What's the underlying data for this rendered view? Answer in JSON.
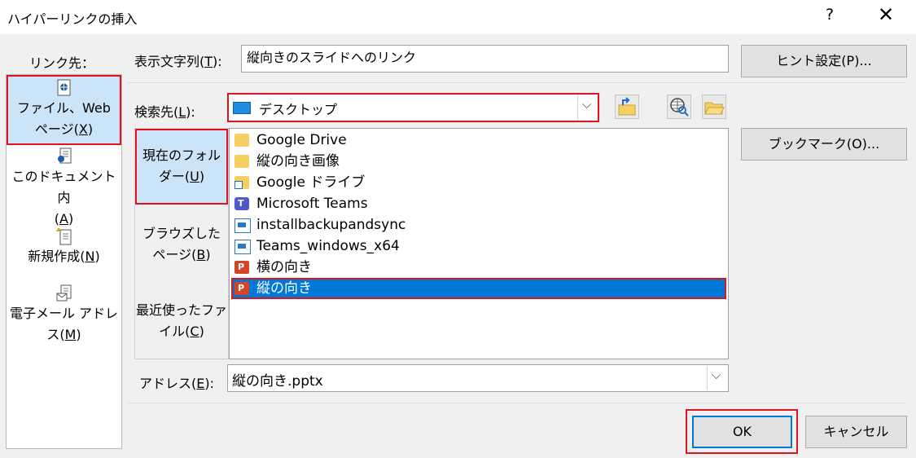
{
  "dialog": {
    "title": "ハイパーリンクの挿入",
    "help": "?",
    "close": "✕"
  },
  "link_to": {
    "label": "リンク先：",
    "items": [
      {
        "line1": "ファイル、Web",
        "line2a": "ページ(",
        "key": "X",
        "line2b": ")",
        "selected": true
      },
      {
        "line1": "このドキュメント内",
        "line2a": "(",
        "key": "A",
        "line2b": ")"
      },
      {
        "line1": "",
        "line2a": "新規作成(",
        "key": "N",
        "line2b": ")"
      },
      {
        "line1": "電子メール アドレ",
        "line2a": "ス(",
        "key": "M",
        "line2b": ")"
      }
    ]
  },
  "display_text": {
    "label_a": "表示文字列(",
    "key": "T",
    "label_b": "):",
    "value": "縦向きのスライドへのリンク"
  },
  "lookin": {
    "label_a": "検索先(",
    "key": "L",
    "label_b": "):",
    "value": "デスクトップ",
    "arrow": "⌵"
  },
  "scope": {
    "items": [
      {
        "line1": "現在のフォル",
        "line2a": "ダー(",
        "key": "U",
        "line2b": ")",
        "selected": true
      },
      {
        "line1": "ブラウズした",
        "line2a": "ページ(",
        "key": "B",
        "line2b": ")"
      },
      {
        "line1": "最近使ったファ",
        "line2a": "イル(",
        "key": "C",
        "line2b": ")"
      }
    ]
  },
  "files": [
    {
      "name": "Google Drive",
      "icon": "folder-icon"
    },
    {
      "name": "縦の向き画像",
      "icon": "folder-icon"
    },
    {
      "name": "Google ドライブ",
      "icon": "shortcut-folder-icon"
    },
    {
      "name": "Microsoft Teams",
      "icon": "teams-icon"
    },
    {
      "name": "installbackupandsync",
      "icon": "installer-icon"
    },
    {
      "name": "Teams_windows_x64",
      "icon": "installer-icon"
    },
    {
      "name": "横の向き",
      "icon": "powerpoint-icon"
    },
    {
      "name": "縦の向き",
      "icon": "powerpoint-icon",
      "selected": true
    }
  ],
  "address": {
    "label_a": "アドレス(",
    "key": "E",
    "label_b": "):",
    "value": "縦の向き.pptx",
    "arrow": "⌵"
  },
  "buttons": {
    "screentip": "ヒント設定(P)...",
    "bookmark": "ブックマーク(O)...",
    "ok": "OK",
    "cancel": "キャンセル"
  },
  "colors": {
    "selection": "#0078d7",
    "highlight_box": "#e0141e",
    "selected_tab": "#cce4f7"
  }
}
